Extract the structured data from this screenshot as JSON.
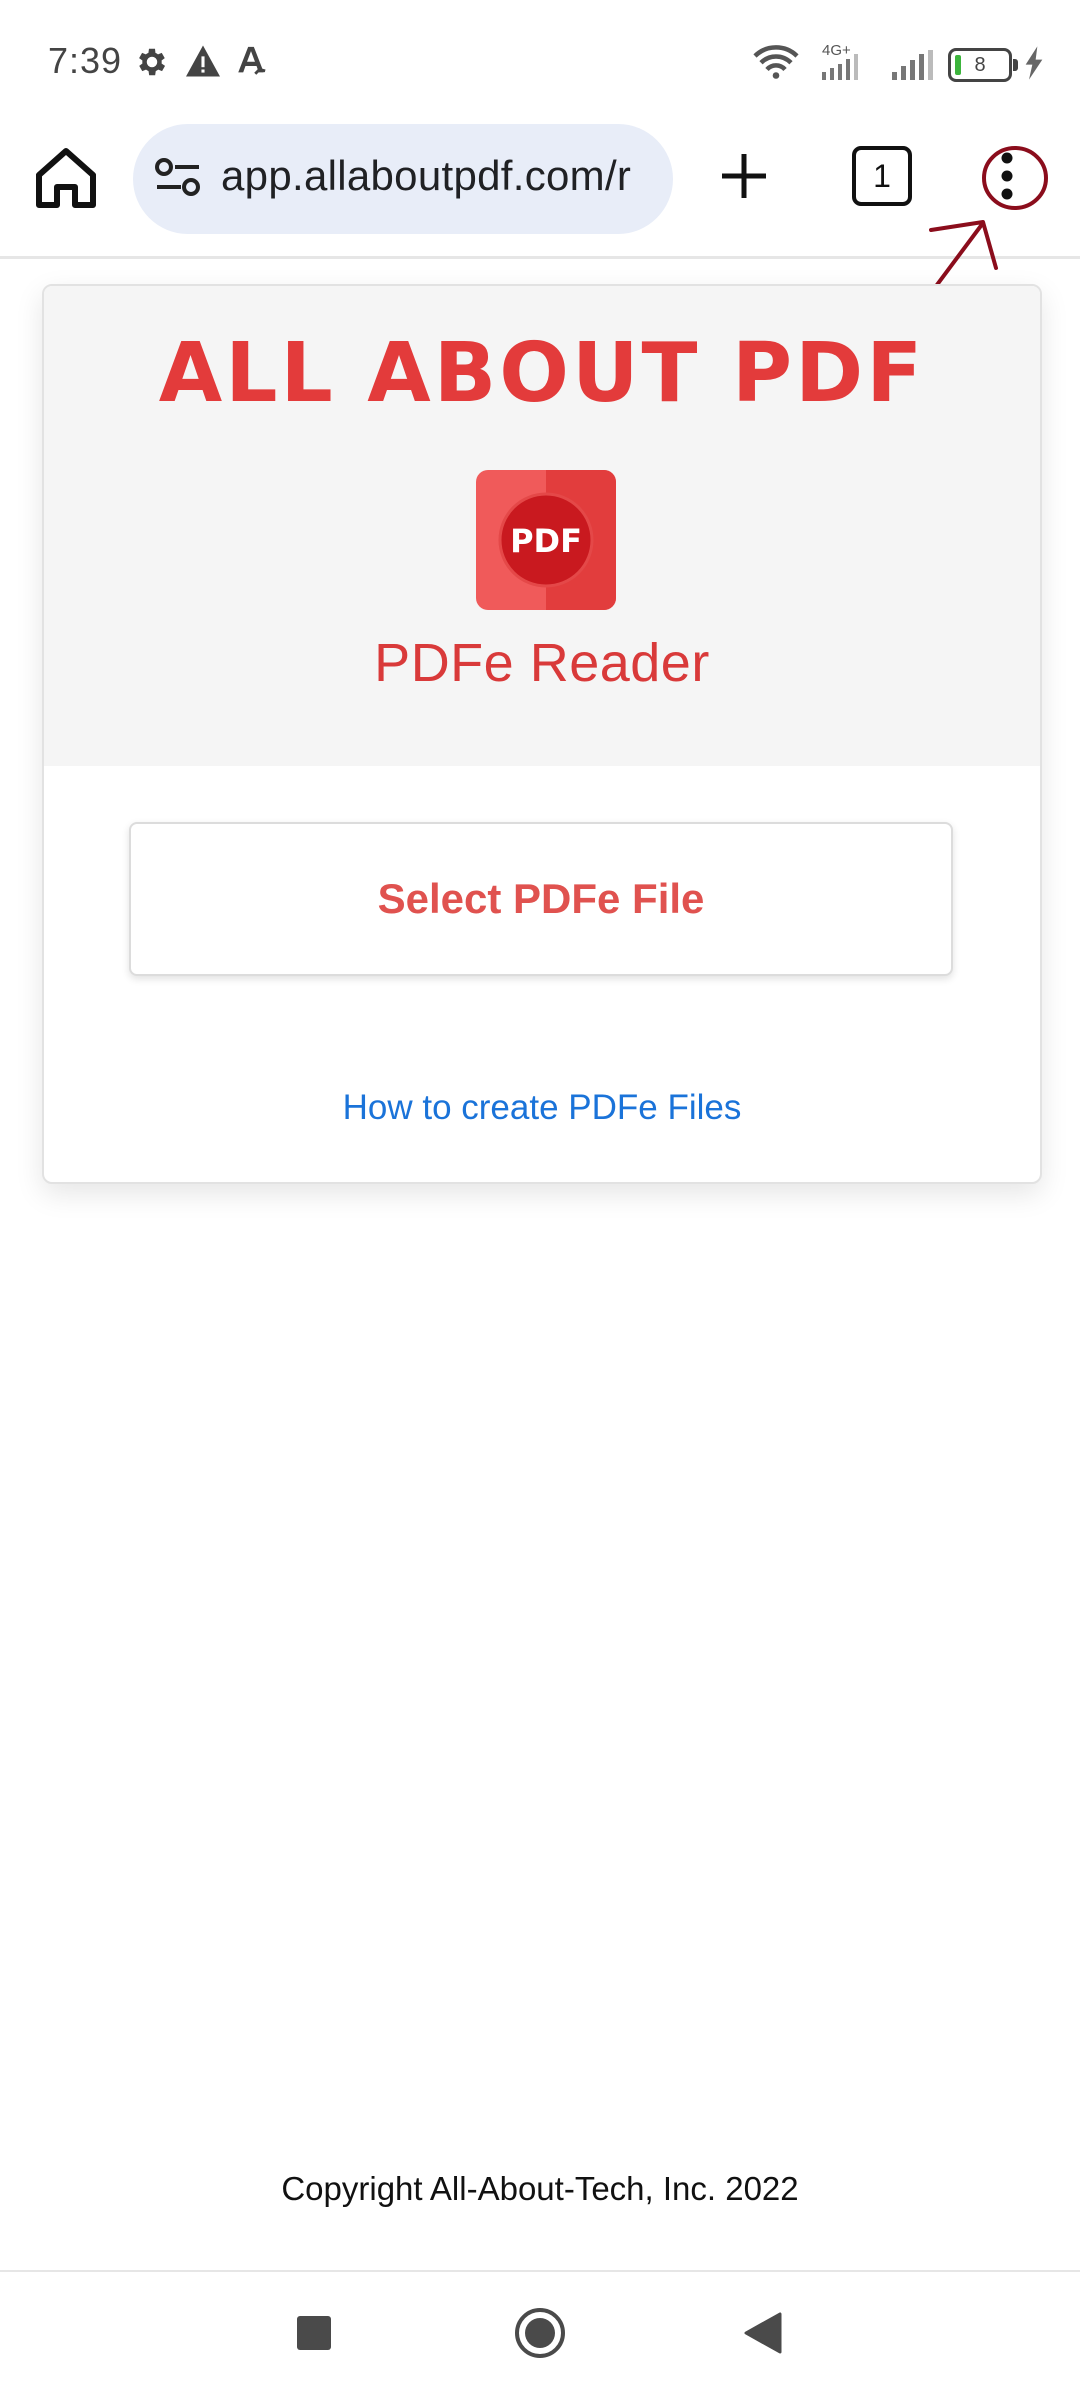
{
  "status_bar": {
    "time": "7:39",
    "battery_level": "8",
    "network_type": "4G+",
    "icons": [
      "settings-icon",
      "warning-icon",
      "font-a-icon",
      "wifi-icon",
      "signal-icon",
      "signal-icon",
      "battery-icon",
      "charging-icon"
    ]
  },
  "browser": {
    "url": "app.allaboutpdf.com/r",
    "tab_count": "1",
    "icons": [
      "home-icon",
      "site-settings-icon",
      "new-tab-icon",
      "tab-switcher-icon",
      "more-menu-icon"
    ]
  },
  "page": {
    "brand_title": "ALL ABOUT PDF",
    "logo_text": "PDF",
    "app_name": "PDFe Reader",
    "select_button": "Select PDFe File",
    "howto_link": "How to create PDFe Files",
    "copyright": "Copyright All-About-Tech, Inc. 2022"
  },
  "colors": {
    "brand_red": "#e33b3b",
    "link_blue": "#1a73d9",
    "annotation": "#8b0d1c",
    "url_bar": "#e8edf8"
  },
  "nav_bar": {
    "icons": [
      "recent-apps-icon",
      "home-circle-icon",
      "back-icon"
    ]
  }
}
